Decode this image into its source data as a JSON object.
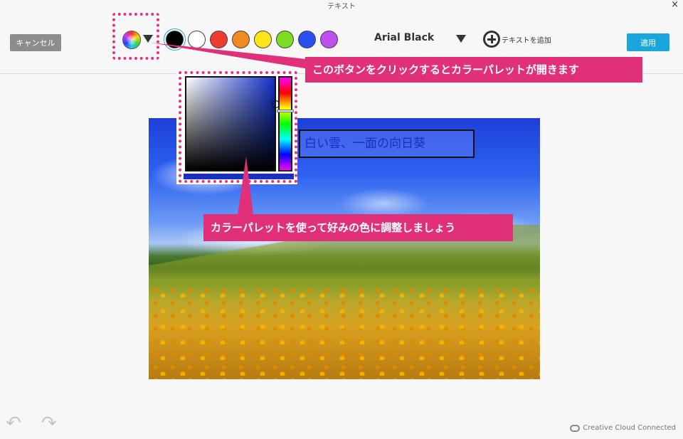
{
  "window": {
    "title": "テキスト",
    "close_glyph": "×"
  },
  "toolbar": {
    "cancel_label": "キャンセル",
    "apply_label": "適用",
    "font_name": "Arial Black",
    "add_text_label": "テキストを追加"
  },
  "swatches": [
    {
      "name": "black",
      "color": "#000000",
      "selected": true
    },
    {
      "name": "white",
      "color": "#ffffff"
    },
    {
      "name": "red",
      "color": "#ee3b2e"
    },
    {
      "name": "orange",
      "color": "#f28a22"
    },
    {
      "name": "yellow",
      "color": "#ffe51a"
    },
    {
      "name": "green",
      "color": "#7ddc24"
    },
    {
      "name": "blue",
      "color": "#2a4ff0"
    },
    {
      "name": "purple",
      "color": "#c04ff0"
    }
  ],
  "canvas": {
    "text_box_value": "白い雲、一面の向日葵",
    "text_color": "#1a2fc8"
  },
  "color_picker": {
    "current_color": "#1a2fc0"
  },
  "annotations": {
    "callout_1": "このボタンをクリックするとカラーパレットが開きます",
    "callout_2": "カラーパレットを使って好みの色に調整しましょう",
    "highlight_color": "#e1307a"
  },
  "footer": {
    "undo_glyph": "↶",
    "redo_glyph": "↷",
    "cc_label": "Creative Cloud Connected"
  }
}
